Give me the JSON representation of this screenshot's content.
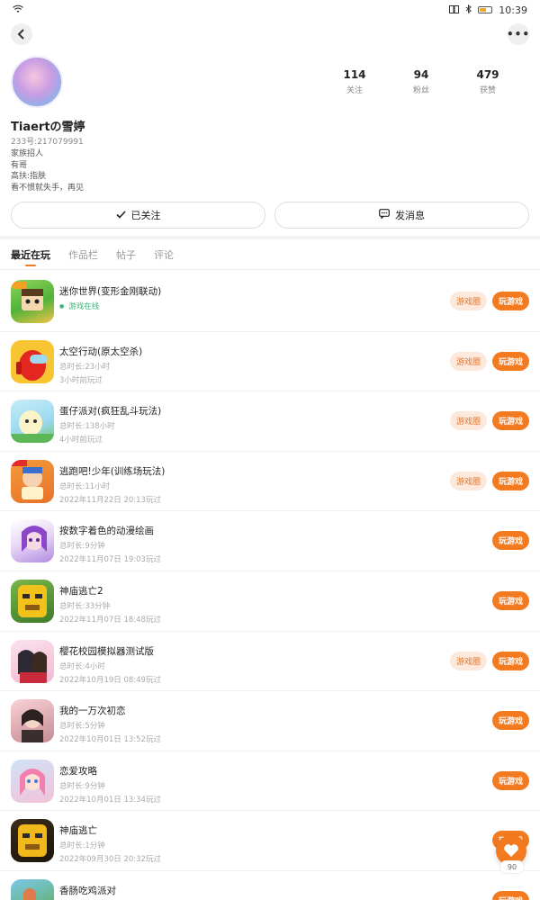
{
  "status_bar": {
    "time": "10:39"
  },
  "profile": {
    "stats": [
      {
        "num": "114",
        "label": "关注"
      },
      {
        "num": "94",
        "label": "粉丝"
      },
      {
        "num": "479",
        "label": "获赞"
      }
    ],
    "username": "Tiaertの雪婷",
    "uid": "233号:217079991",
    "bio_lines": [
      "家族招人",
      "有哥",
      "高扶:指肤",
      "看不惯就失手，再见"
    ]
  },
  "actions": {
    "follow_label": "已关注",
    "message_label": "发消息"
  },
  "tabs": [
    "最近在玩",
    "作品栏",
    "帖子",
    "评论"
  ],
  "games": [
    {
      "title": "迷你世界(变形金刚联动)",
      "line1": "游戏在线",
      "line2": "",
      "circle": "游戏圈",
      "play": "玩游戏"
    },
    {
      "title": "太空行动(原太空杀)",
      "line1": "总时长:23小时",
      "line2": "3小时前玩过",
      "circle": "游戏圈",
      "play": "玩游戏"
    },
    {
      "title": "蛋仔派对(疯狂乱斗玩法)",
      "line1": "总时长:138小时",
      "line2": "4小时前玩过",
      "circle": "游戏圈",
      "play": "玩游戏"
    },
    {
      "title": "逃跑吧!少年(训练场玩法)",
      "line1": "总时长:11小时",
      "line2": "2022年11月22日 20:13玩过",
      "circle": "游戏圈",
      "play": "玩游戏"
    },
    {
      "title": "按数字着色的动漫绘画",
      "line1": "总时长:9分钟",
      "line2": "2022年11月07日 19:03玩过",
      "circle": "",
      "play": "玩游戏"
    },
    {
      "title": "神庙逃亡2",
      "line1": "总时长:33分钟",
      "line2": "2022年11月07日 18:48玩过",
      "circle": "",
      "play": "玩游戏"
    },
    {
      "title": "樱花校园模拟器测试版",
      "line1": "总时长:4小时",
      "line2": "2022年10月19日 08:49玩过",
      "circle": "游戏圈",
      "play": "玩游戏"
    },
    {
      "title": "我的一万次初恋",
      "line1": "总时长:5分钟",
      "line2": "2022年10月01日 13:52玩过",
      "circle": "",
      "play": "玩游戏"
    },
    {
      "title": "恋爱攻略",
      "line1": "总时长:9分钟",
      "line2": "2022年10月01日 13:34玩过",
      "circle": "",
      "play": "玩游戏"
    },
    {
      "title": "神庙逃亡",
      "line1": "总时长:1分钟",
      "line2": "2022年09月30日 20:32玩过",
      "circle": "",
      "play": "玩游戏"
    },
    {
      "title": "香肠吃鸡派对",
      "line1": "",
      "line2": "",
      "circle": "",
      "play": "玩游戏"
    }
  ],
  "float": {
    "like_count": "90"
  },
  "colors": {
    "accent": "#f47a20",
    "accent_light": "#fde9dc",
    "online": "#39b57a"
  },
  "icons": {
    "back": "back-arrow-icon",
    "more": "more-dots-icon",
    "follow": "checkmark-icon",
    "message": "chat-bubble-icon",
    "like": "heart-icon"
  }
}
